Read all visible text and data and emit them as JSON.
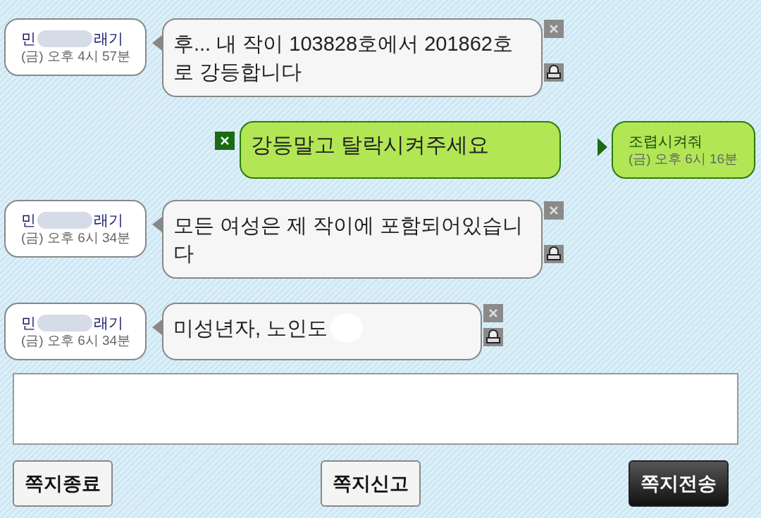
{
  "messages": [
    {
      "kind": "received",
      "name_start": "민",
      "name_end": "래기",
      "time": "(금) 오후 4시 57분",
      "text": "후... 내 작이 103828호에서 201862호로 강등합니다",
      "redacted_tail": false
    },
    {
      "kind": "sent",
      "name_start": "조렵시켜줘",
      "time": "(금) 오후 6시 16분",
      "text": "강등말고 탈락시켜주세요"
    },
    {
      "kind": "received",
      "name_start": "민",
      "name_end": "래기",
      "time": "(금) 오후 6시 34분",
      "text": "모든 여성은 제 작이에 포함되어있습니다",
      "redacted_tail": false
    },
    {
      "kind": "received",
      "name_start": "민",
      "name_end": "래기",
      "time": "(금) 오후 6시 34분",
      "text": "미성년자, 노인도",
      "redacted_tail": true
    }
  ],
  "buttons": [
    {
      "label": "쪽지종료",
      "kind": "normal"
    },
    {
      "label": "쪽지신고",
      "kind": "normal"
    },
    {
      "label": "쪽지전송",
      "kind": "primary"
    }
  ]
}
